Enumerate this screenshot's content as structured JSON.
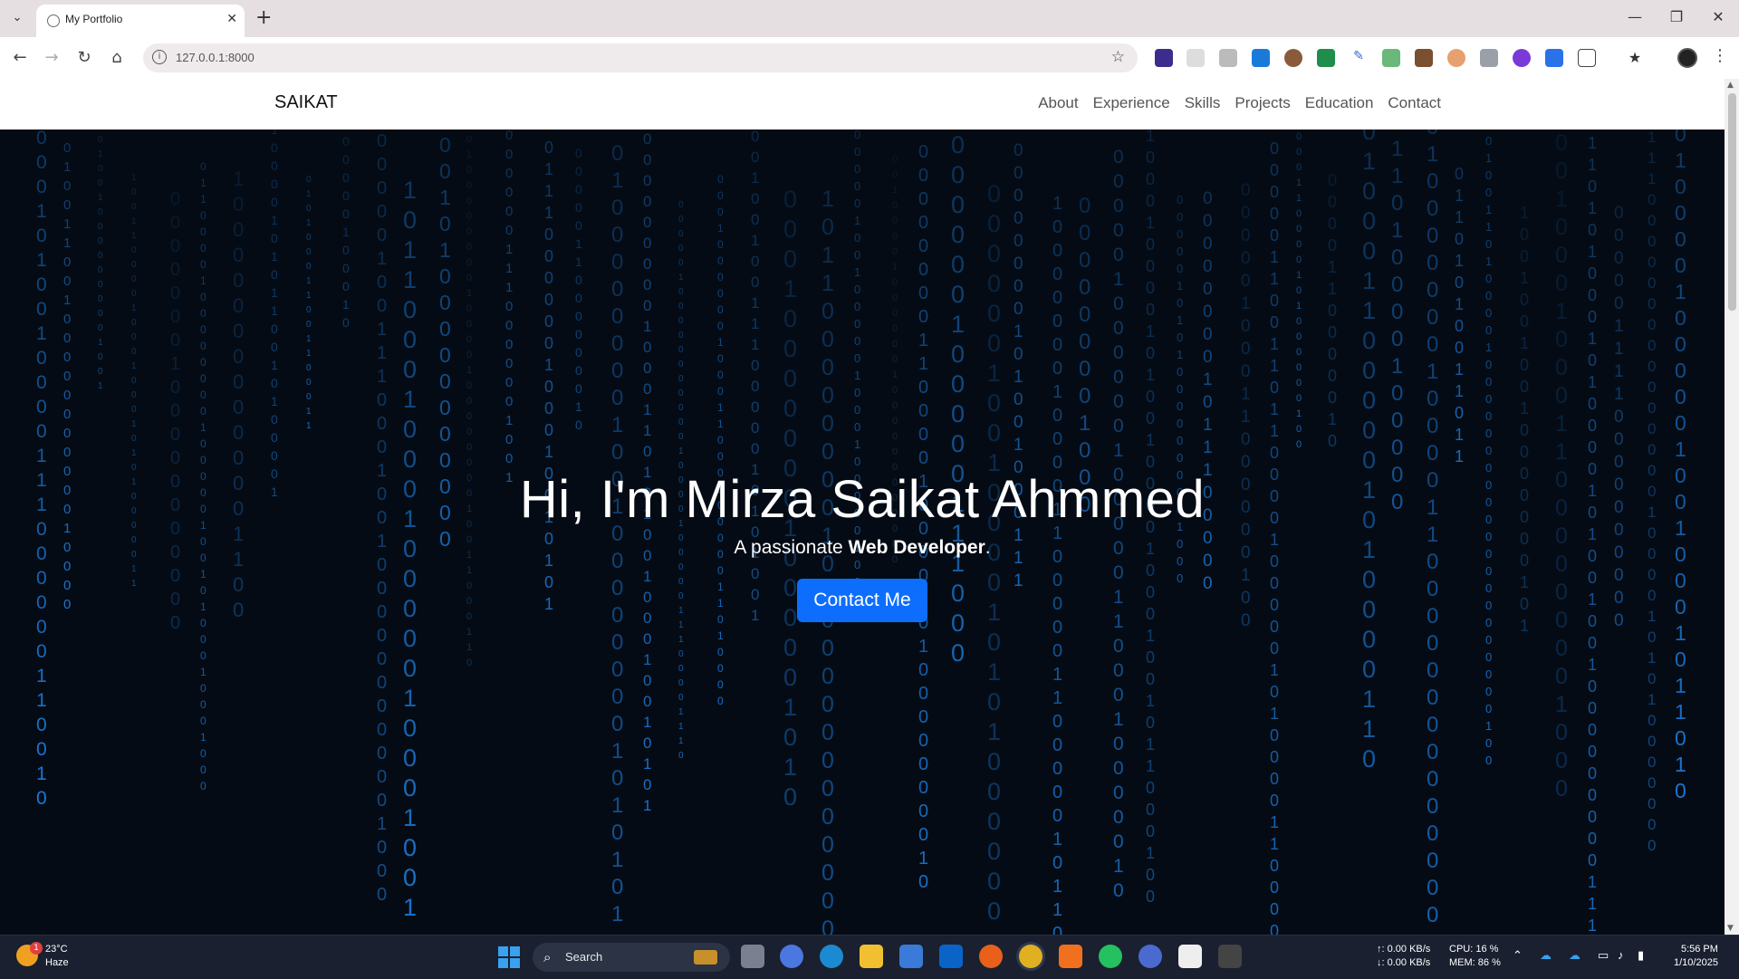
{
  "browser": {
    "tab_title": "My Portfolio",
    "tab_close": "✕",
    "new_tab": "+",
    "url": "127.0.0.1:8000",
    "window_controls": [
      "—",
      "❐",
      "✕"
    ]
  },
  "site": {
    "brand": "SAIKAT",
    "nav": [
      "About",
      "Experience",
      "Skills",
      "Projects",
      "Education",
      "Contact"
    ],
    "hero_title": "Hi, I'm Mirza Saikat Ahmmed",
    "hero_sub_prefix": "A passionate ",
    "hero_sub_role": "Web Developer",
    "hero_sub_suffix": ".",
    "cta": "Contact Me",
    "colors": {
      "hero_bg": "#050b14",
      "rain": "#1e90ff",
      "button": "#0d6efd"
    }
  },
  "taskbar": {
    "weather_temp": "23°C",
    "weather_desc": "Haze",
    "weather_badge": "1",
    "search_label": "Search",
    "net_up": "↑: 0.00 KB/s",
    "net_down": "↓: 0.00 KB/s",
    "cpu": "CPU: 16 %",
    "mem": "MEM: 86 %",
    "time": "5:56 PM",
    "date": "1/10/2025"
  }
}
